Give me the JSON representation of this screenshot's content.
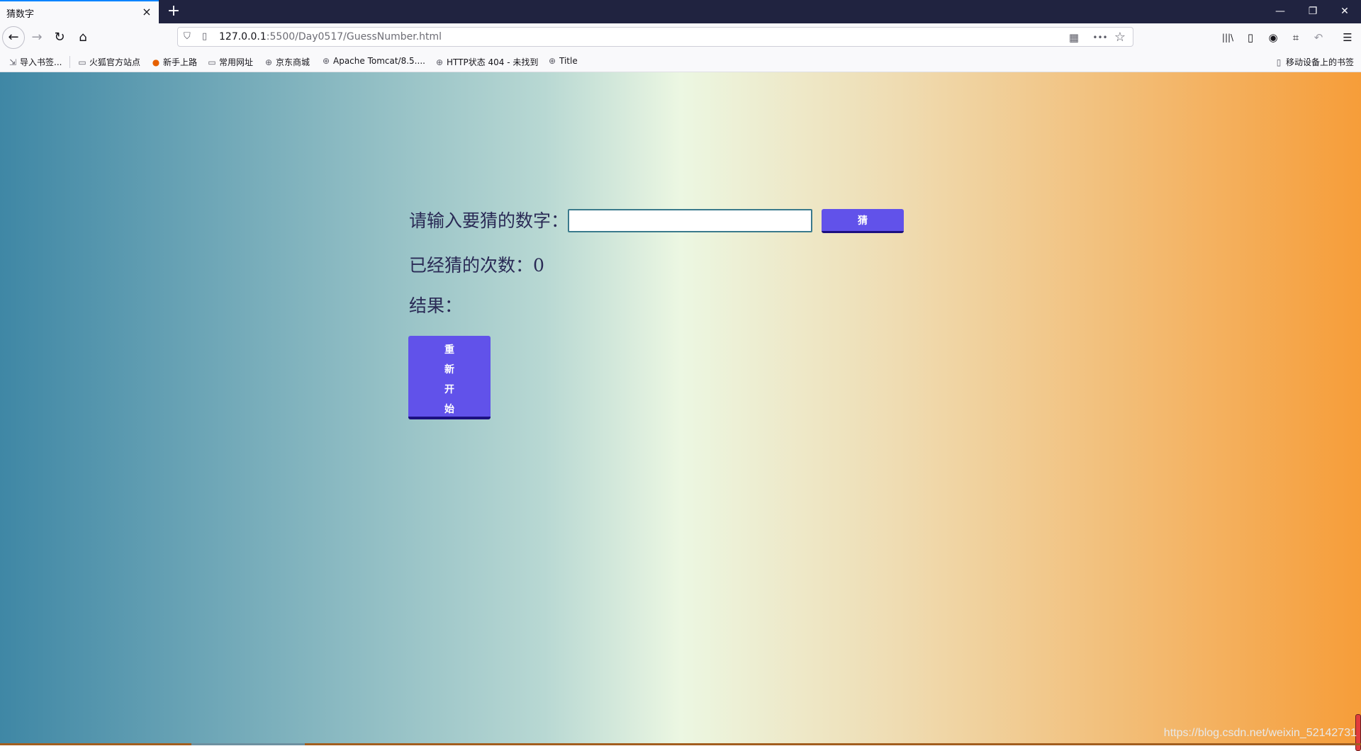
{
  "browser": {
    "tab_title": "猜数字",
    "tab_close_icon": "×",
    "new_tab_icon": "+",
    "window_controls": {
      "minimize": "—",
      "restore": "❐",
      "close": "✕"
    },
    "nav": {
      "back": "←",
      "forward": "→",
      "reload": "↻",
      "home": "⌂"
    },
    "url": {
      "host": "127.0.0.1",
      "path": ":5500/Day0517/GuessNumber.html"
    },
    "url_actions": {
      "qr": "▦",
      "more": "•••",
      "bookmark": "☆"
    },
    "toolbar_icons": {
      "library": "|||\\",
      "sidebar": "▯",
      "account": "◉",
      "screenshot": "⌗",
      "undo": "↶",
      "menu": "☰"
    },
    "bookmarks": [
      {
        "icon": "⇲",
        "label": "导入书签..."
      },
      {
        "icon": "▭",
        "label": "火狐官方站点"
      },
      {
        "icon": "●",
        "label": "新手上路"
      },
      {
        "icon": "▭",
        "label": "常用网址"
      },
      {
        "icon": "⊕",
        "label": "京东商城"
      },
      {
        "icon": "⊕",
        "label": "Apache Tomcat/8.5...."
      },
      {
        "icon": "⊕",
        "label": "HTTP状态 404 - 未找到"
      },
      {
        "icon": "⊕",
        "label": "Title"
      }
    ],
    "mobile_bookmarks": {
      "icon": "▯",
      "label": "移动设备上的书签"
    }
  },
  "game": {
    "prompt_label": "请输入要猜的数字：",
    "guess_input_value": "",
    "guess_button": "猜",
    "count_label": "已经猜的次数：",
    "count_value": "0",
    "result_label": "结果：",
    "result_value": "",
    "restart_chars": [
      "重",
      "新",
      "开",
      "始"
    ]
  },
  "watermark": "https://blog.csdn.net/weixin_52142731",
  "colors": {
    "button": "#6152ea",
    "gradient_left": "#3f87a5",
    "gradient_mid": "#ecf7e2",
    "gradient_right": "#f69d39"
  }
}
